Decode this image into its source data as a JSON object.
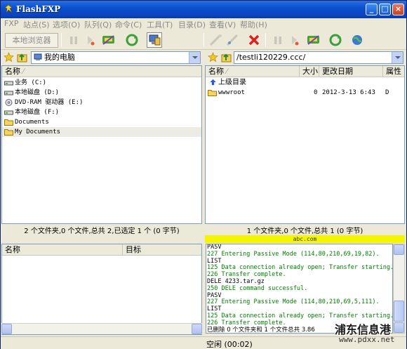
{
  "window": {
    "title": "FlashFXP",
    "min_label": "_",
    "max_label": "□",
    "close_label": "×"
  },
  "menu": [
    "FXP",
    "站点(S)",
    "选项(O)",
    "队列(Q)",
    "命令(C)",
    "工具(T)",
    "目录(D)",
    "查看(V)",
    "帮助(H)"
  ],
  "toolbar": {
    "local_browser_label": "本地浏览器"
  },
  "left": {
    "path": "我的电脑",
    "col_name": "名称",
    "items": [
      {
        "name": "业务 (C:)",
        "icon": "drive-icon"
      },
      {
        "name": "本地磁盘 (D:)",
        "icon": "drive-icon"
      },
      {
        "name": "DVD-RAM 驱动器 (E:)",
        "icon": "dvd-icon"
      },
      {
        "name": "本地磁盘 (F:)",
        "icon": "drive-icon"
      },
      {
        "name": "Documents",
        "icon": "folder-icon"
      },
      {
        "name": "My Documents",
        "icon": "folder-icon"
      }
    ],
    "status": "2 个文件夹,0 个文件,总共 2,已选定 1 个 (0 字节)"
  },
  "right": {
    "path": "/testli120229.ccc/",
    "col_name": "名称",
    "col_size": "大小",
    "col_date": "更改日期",
    "col_attr": "属性",
    "up_label": "上级目录",
    "items": [
      {
        "name": "wwwroot",
        "size": "0",
        "date": "2012-3-13 6:43",
        "attr": "D"
      }
    ],
    "status": "1 个文件夹,0 个文件,总共 1 (0 字节)",
    "site": "abc.com"
  },
  "queue": {
    "col_name": "名称",
    "col_target": "目标"
  },
  "log": {
    "lines": [
      {
        "text": "PASV",
        "color": "#000000"
      },
      {
        "text": "227 Entering Passive Mode (114,80,210,69,19,82).",
        "color": "#008000"
      },
      {
        "text": "LIST",
        "color": "#000000"
      },
      {
        "text": "125 Data connection already open; Transfer starting.",
        "color": "#008000"
      },
      {
        "text": "226 Transfer complete.",
        "color": "#008000"
      },
      {
        "text": "DELE 4233.tar.gz",
        "color": "#000000"
      },
      {
        "text": "250 DELE command successful.",
        "color": "#008000"
      },
      {
        "text": "PASV",
        "color": "#000000"
      },
      {
        "text": "227 Entering Passive Mode (114,80,210,69,5,111).",
        "color": "#008000"
      },
      {
        "text": "LIST",
        "color": "#000000"
      },
      {
        "text": "125 Data connection already open; Transfer starting.",
        "color": "#008000"
      },
      {
        "text": "226 Transfer complete.",
        "color": "#008000"
      },
      {
        "text": "已删除 0 个文件夹和 1 个文件总共 3.86",
        "color": "#000000"
      }
    ]
  },
  "statusbar": {
    "text": "空闲 (00:02)"
  },
  "watermark": {
    "text": "浦东信息港",
    "url": "www.pdxx.net"
  }
}
